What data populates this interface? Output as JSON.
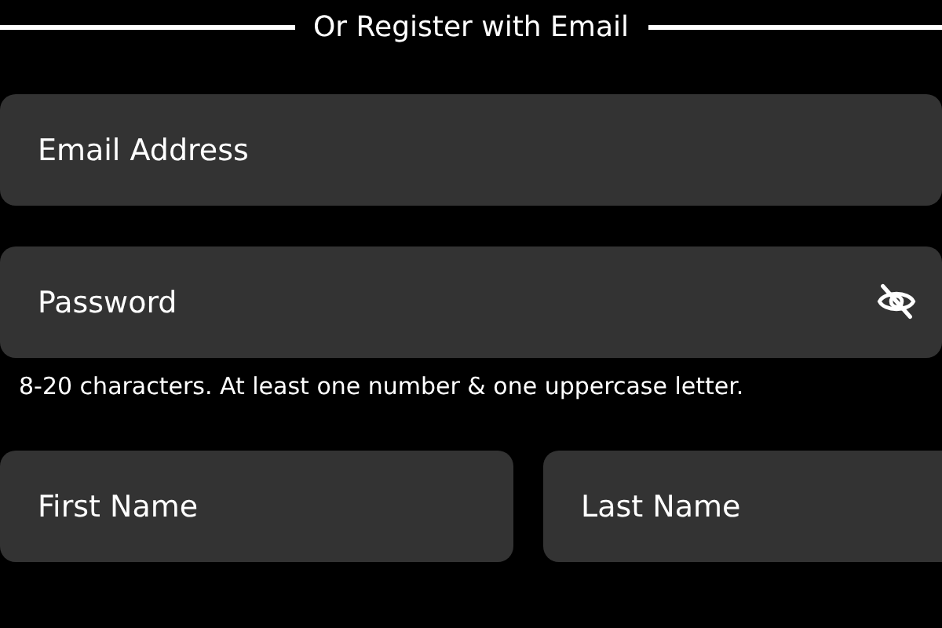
{
  "divider": {
    "label": "Or Register with Email"
  },
  "email": {
    "placeholder": "Email Address"
  },
  "password": {
    "placeholder": "Password",
    "hint": "8-20 characters. At least one number & one uppercase letter."
  },
  "name_fields": [
    {
      "placeholder": "First Name"
    },
    {
      "placeholder": "Last Name"
    }
  ]
}
